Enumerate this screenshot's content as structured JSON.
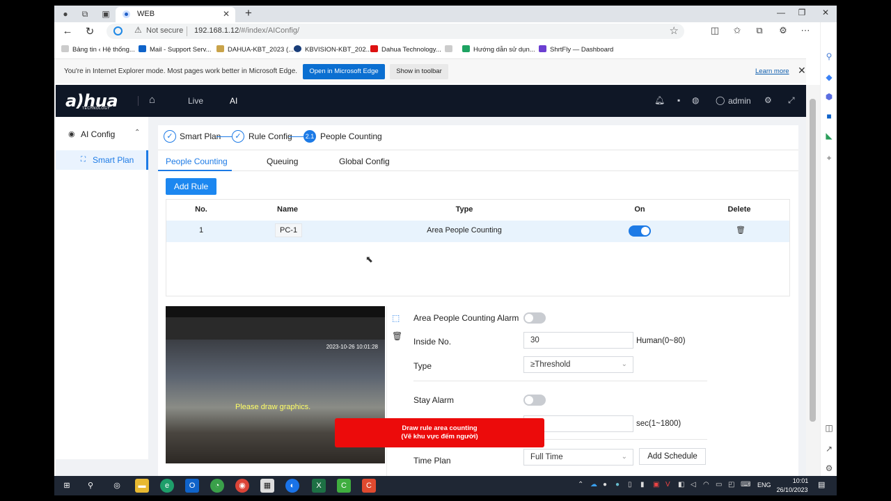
{
  "browser": {
    "tab_title": "WEB",
    "not_secure": "Not secure",
    "url_host": "192.168.1.12",
    "url_path": "/#/index/AIConfig/",
    "favorites": [
      "Bảng tin ‹ Hệ thống...",
      "Mail - Support Serv...",
      "DAHUA-KBT_2023 (...",
      "KBVISION-KBT_202...",
      "Dahua Technology...",
      "Hướng dẫn sử dụn...",
      "ShrtFly — Dashboard"
    ],
    "ie_banner": {
      "text": "You're in Internet Explorer mode. Most pages work better in Microsoft Edge.",
      "open_edge": "Open in Microsoft Edge",
      "show_toolbar": "Show in toolbar",
      "learn_more": "Learn more"
    }
  },
  "app": {
    "logo": "a)hua",
    "logo_sub": "TECHNOLOGY",
    "nav": [
      "Live",
      "AI"
    ],
    "user": "admin",
    "sidebar": {
      "group": "AI Config",
      "item": "Smart Plan"
    },
    "steps": [
      {
        "label": "Smart Plan",
        "icon": "✓"
      },
      {
        "label": "Rule Config",
        "icon": "✓"
      },
      {
        "label": "People Counting",
        "icon": "2.1"
      }
    ],
    "subtabs": [
      "People Counting",
      "Queuing",
      "Global Config"
    ],
    "add_rule": "Add Rule",
    "table": {
      "headers": [
        "No.",
        "Name",
        "Type",
        "On",
        "Delete"
      ],
      "rows": [
        {
          "no": "1",
          "name": "PC-1",
          "type": "Area People Counting",
          "on": true
        }
      ]
    },
    "video": {
      "timestamp": "2023-10-26 10:01:28",
      "hint": "Please draw graphics."
    },
    "form": {
      "alarm_label": "Area People Counting Alarm",
      "inside_label": "Inside No.",
      "inside_value": "30",
      "inside_unit": "Human(0~80)",
      "type_label": "Type",
      "type_value": "≥Threshold",
      "stay_label": "Stay Alarm",
      "stay_unit": "sec(1~1800)",
      "timeplan_label": "Time Plan",
      "timeplan_value": "Full Time",
      "add_schedule": "Add Schedule"
    },
    "overlay": {
      "line1": "Draw rule area counting",
      "line2": "(Vẽ khu vực đếm người)"
    }
  },
  "taskbar": {
    "lang": "ENG",
    "time": "10:01",
    "date": "26/10/2023"
  }
}
